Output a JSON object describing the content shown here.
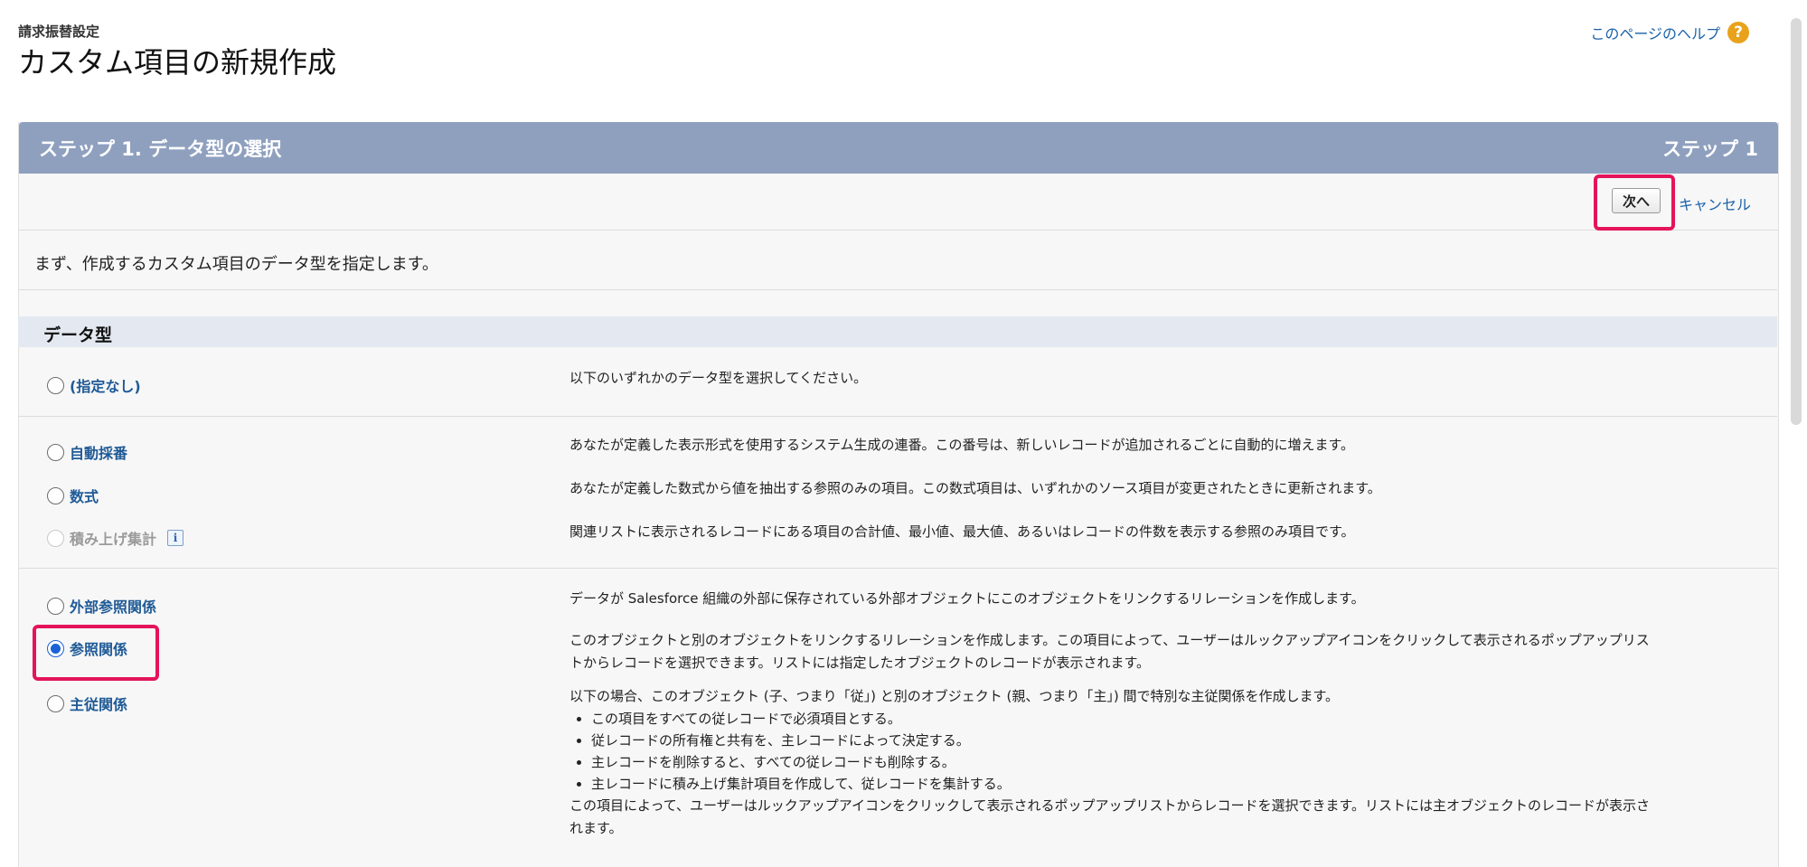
{
  "header": {
    "breadcrumb": "請求振替設定",
    "title": "カスタム項目の新規作成",
    "help_link": "このページのヘルプ",
    "help_icon": "?"
  },
  "panel": {
    "title": "ステップ 1. データ型の選択",
    "step_label": "ステップ 1",
    "next_button": "次へ",
    "cancel_link": "キャンセル",
    "intro": "まず、作成するカスタム項目のデータ型を指定します。"
  },
  "section": {
    "title": "データ型"
  },
  "options": {
    "none": {
      "label": "(指定なし)",
      "desc": "以下のいずれかのデータ型を選択してください。"
    },
    "autonumber": {
      "label": "自動採番",
      "desc": "あなたが定義した表示形式を使用するシステム生成の連番。この番号は、新しいレコードが追加されるごとに自動的に増えます。"
    },
    "formula": {
      "label": "数式",
      "desc": "あなたが定義した数式から値を抽出する参照のみの項目。この数式項目は、いずれかのソース項目が変更されたときに更新されます。"
    },
    "rollup": {
      "label": "積み上げ集計",
      "info_icon": "i",
      "desc": "関連リストに表示されるレコードにある項目の合計値、最小値、最大値、あるいはレコードの件数を表示する参照のみ項目です。"
    },
    "external": {
      "label": "外部参照関係",
      "desc": "データが Salesforce 組織の外部に保存されている外部オブジェクトにこのオブジェクトをリンクするリレーションを作成します。"
    },
    "lookup": {
      "label": "参照関係",
      "desc_line1": "このオブジェクトと別のオブジェクトをリンクするリレーションを作成します。この項目によって、ユーザーはルックアップアイコンをクリックして表示されるポップアップリス",
      "desc_line2": "トからレコードを選択できます。リストには指定したオブジェクトのレコードが表示されます。"
    },
    "master": {
      "label": "主従関係",
      "desc_intro": "以下の場合、このオブジェクト (子、つまり「従」) と別のオブジェクト (親、つまり「主」) 間で特別な主従関係を作成します。",
      "bullets": [
        "この項目をすべての従レコードで必須項目とする。",
        "従レコードの所有権と共有を、主レコードによって決定する。",
        "主レコードを削除すると、すべての従レコードも削除する。",
        "主レコードに積み上げ集計項目を作成して、従レコードを集計する。"
      ],
      "desc_outro_line1": "この項目によって、ユーザーはルックアップアイコンをクリックして表示されるポップアップリストからレコードを選択できます。リストには主オブジェクトのレコードが表示さ",
      "desc_outro_line2": "れます。"
    }
  },
  "selected_option": "参照関係",
  "colors": {
    "header_bar": "#8fa0bf",
    "highlight": "#e4145a",
    "link": "#1a62a8"
  }
}
